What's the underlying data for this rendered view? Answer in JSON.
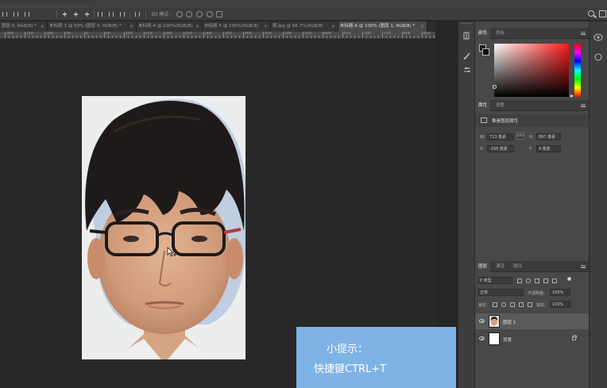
{
  "tabs": [
    {
      "label": "图层 0, RGB/8) *",
      "active": false
    },
    {
      "label": "未标题-3 @ 50% (图层 0, RGB/8) *",
      "active": false
    },
    {
      "label": "未标题-4 @ 100%(RGB/8)",
      "active": false
    },
    {
      "label": "未标题-5 @ 100%(RGB/8)",
      "active": false
    },
    {
      "label": "题.jpg @ 66.7%(RGB/8)",
      "active": false
    },
    {
      "label": "未标题-6 @ 100% (图层 1, RGB/8) *",
      "active": true
    }
  ],
  "options": {
    "mode_3d": "3D 模式:"
  },
  "ruler": {
    "labels": [
      "200",
      "150",
      "100",
      "50",
      "0",
      "50",
      "100",
      "150",
      "200",
      "250",
      "300",
      "350",
      "400",
      "450",
      "500",
      "550",
      "600",
      "650",
      "700",
      "750",
      "800",
      "850"
    ]
  },
  "colors": {
    "canvas_bg": "#282828",
    "tip_bg": "#7fb3e6",
    "panel_bg": "#484848"
  },
  "color_panel": {
    "tabs": [
      "颜色",
      "色板"
    ]
  },
  "properties_panel": {
    "tabs": [
      "属性",
      "调整"
    ],
    "header": "像素图层属性",
    "w_label": "W:",
    "w_value": "713 像素",
    "h_label": "H:",
    "h_value": "897 像素",
    "x_label": "X:",
    "x_value": "-156 像素",
    "y_label": "Y:",
    "y_value": "4 像素",
    "link_symbol": "GO"
  },
  "layers_panel": {
    "tabs": [
      "图层",
      "通道",
      "路径"
    ],
    "filter_kind": "P 类型",
    "blend_mode": "正常",
    "opacity_label": "不透明度:",
    "opacity_value": "100%",
    "lock_label": "锁定:",
    "fill_label": "填充:",
    "fill_value": "100%",
    "layers": [
      {
        "name": "图层 1",
        "selected": true,
        "thumb": "photo"
      },
      {
        "name": "背景",
        "selected": false,
        "thumb": "white"
      }
    ]
  },
  "tip": {
    "title": "小提示：",
    "text": "快捷键CTRL+T"
  }
}
